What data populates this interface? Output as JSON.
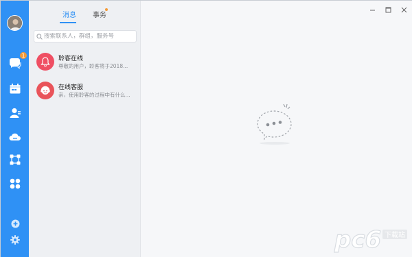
{
  "colors": {
    "rail": "#2f91f5",
    "accent": "#2f91f5",
    "badge": "#f59b38",
    "list_bg": "#eef0f3",
    "main_bg": "#f6f7f9",
    "conv1_avatar": "#ef4f63",
    "conv2_avatar": "#e9545a"
  },
  "rail": {
    "avatar": "user-avatar",
    "items": [
      {
        "icon": "chat-bubbles-icon",
        "badge": "1"
      },
      {
        "icon": "calendar-icon"
      },
      {
        "icon": "contacts-icon"
      },
      {
        "icon": "cloud-icon"
      },
      {
        "icon": "apps-network-icon"
      },
      {
        "icon": "clover-grid-icon"
      }
    ],
    "bottom_items": [
      {
        "icon": "add-circle-icon"
      },
      {
        "icon": "settings-gear-icon"
      }
    ]
  },
  "tabs": [
    {
      "label": "消息",
      "active": true
    },
    {
      "label": "事务",
      "active": false,
      "has_dot": true
    }
  ],
  "search": {
    "placeholder": "搜索联系人，群组，服务号"
  },
  "conversations": [
    {
      "name": "聆客在线",
      "preview": "尊敬的用户，聆客将于2018...",
      "icon": "bell-icon"
    },
    {
      "name": "在线客服",
      "preview": "亲，使用聆客的过程中有什么...",
      "icon": "support-agent-icon"
    }
  ],
  "window_controls": [
    "minimize-icon",
    "maximize-icon",
    "close-icon"
  ],
  "empty_state": {
    "icon": "empty-chat-bubble-icon"
  },
  "watermark": {
    "text": "pc6",
    "sub": "下载站"
  }
}
